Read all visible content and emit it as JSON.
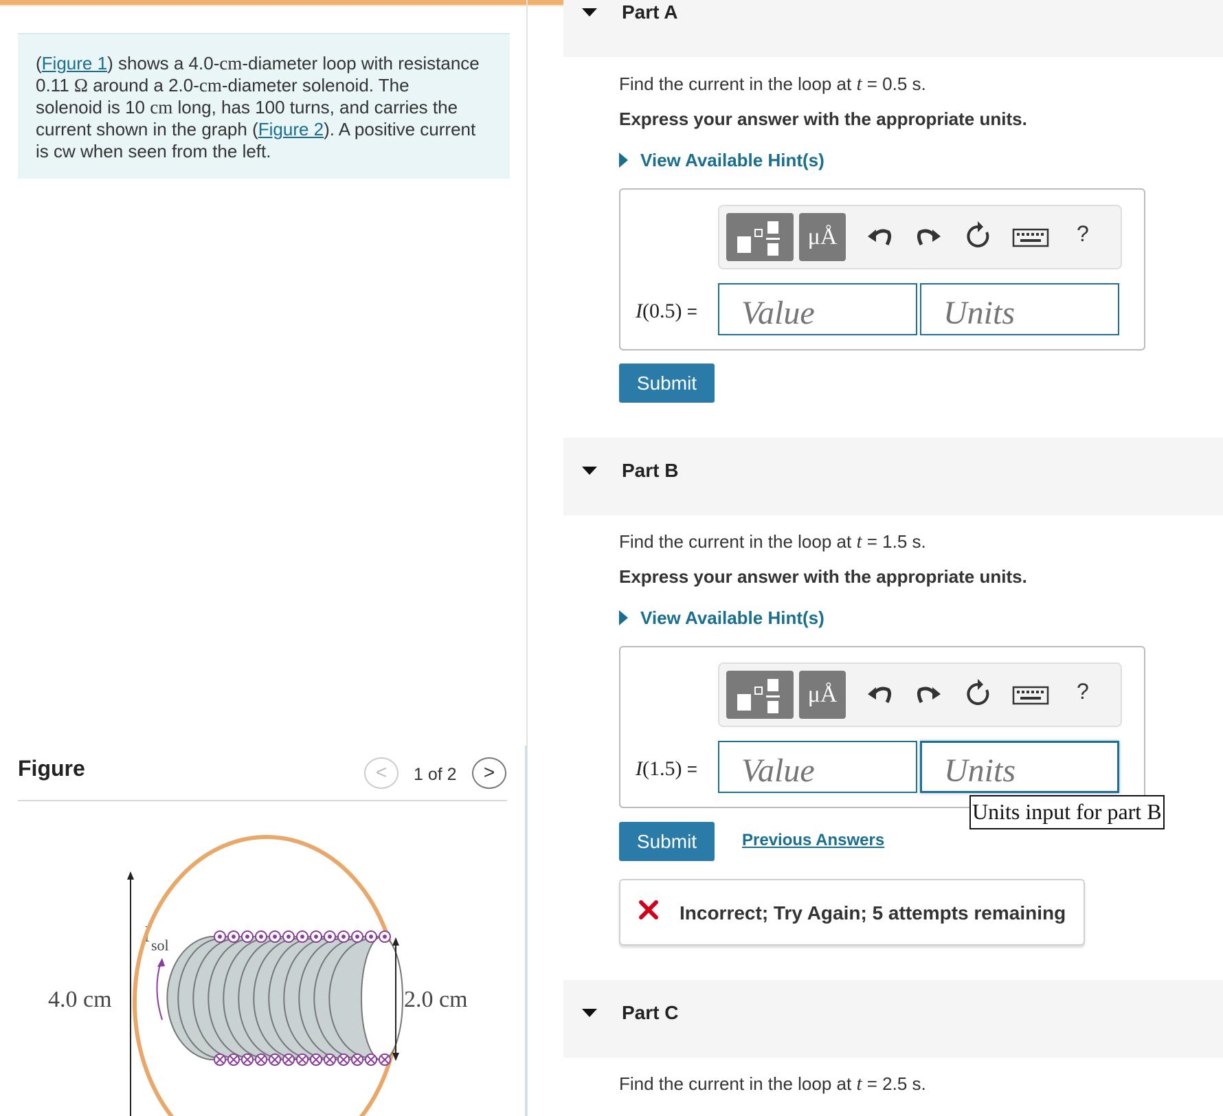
{
  "problem": {
    "figure1_link": "Figure 1",
    "t1": ") shows a 4.0-",
    "cm1": "cm",
    "t2": "-diameter loop with resistance",
    "resistance": "0.11",
    "ohm": "Ω",
    "t3": " around a 2.0-",
    "cm2": "cm",
    "t4": "-diameter solenoid.  The",
    "t5": "solenoid is 10 ",
    "cm3": "cm",
    "t6": " long, has 100 turns, and carries the",
    "t7": "current shown in the graph (",
    "figure2_link": "Figure 2",
    "t8": "). A positive current",
    "t9": "is cw when seen from the left."
  },
  "figure": {
    "title": "Figure",
    "prev": "<",
    "next": ">",
    "counter": "1 of 2",
    "labels": {
      "loop_diameter": "4.0 cm",
      "solenoid_diameter": "2.0 cm",
      "current_symbol": "I",
      "current_subscript": "sol"
    },
    "colors": {
      "loop": "#e8a86a",
      "solenoid": "#c9d2d2",
      "coil_dots": "#8a3d9c"
    }
  },
  "parts": [
    {
      "label": "Part A",
      "question_pre": "Find the current in the loop at ",
      "question_var": "t",
      "question_post": " = 0.5 s.",
      "instruction": "Express your answer with the appropriate units.",
      "hint": "View Available Hint(s)",
      "eq_var": "I",
      "eq_arg": "(0.5)",
      "eq_sign": " =",
      "value_placeholder": "Value",
      "units_placeholder": "Units",
      "toolbar_unit_symbol": "μÅ",
      "toolbar_help": "?",
      "toolbar_icons": [
        "templates-icon",
        "units-icon",
        "undo-icon",
        "redo-icon",
        "reset-icon",
        "keyboard-icon",
        "help-icon"
      ],
      "submit": "Submit"
    },
    {
      "label": "Part B",
      "question_pre": "Find the current in the loop at ",
      "question_var": "t",
      "question_post": " = 1.5 s.",
      "instruction": "Express your answer with the appropriate units.",
      "hint": "View Available Hint(s)",
      "eq_var": "I",
      "eq_arg": "(1.5)",
      "eq_sign": " =",
      "value_placeholder": "Value",
      "units_placeholder": "Units",
      "toolbar_unit_symbol": "μÅ",
      "toolbar_help": "?",
      "submit": "Submit",
      "previous_answers": "Previous Answers",
      "tooltip": "Units input for part B",
      "feedback": "Incorrect; Try Again; 5 attempts remaining",
      "feedback_color": "#d0021b"
    },
    {
      "label": "Part C",
      "question_pre": "Find the current in the loop at ",
      "question_var": "t",
      "question_post": " = 2.5 s."
    }
  ],
  "colors": {
    "accent": "#2a7ba7",
    "link": "#1a6e8e",
    "error": "#d0021b",
    "top_strip": "#f0b070"
  }
}
